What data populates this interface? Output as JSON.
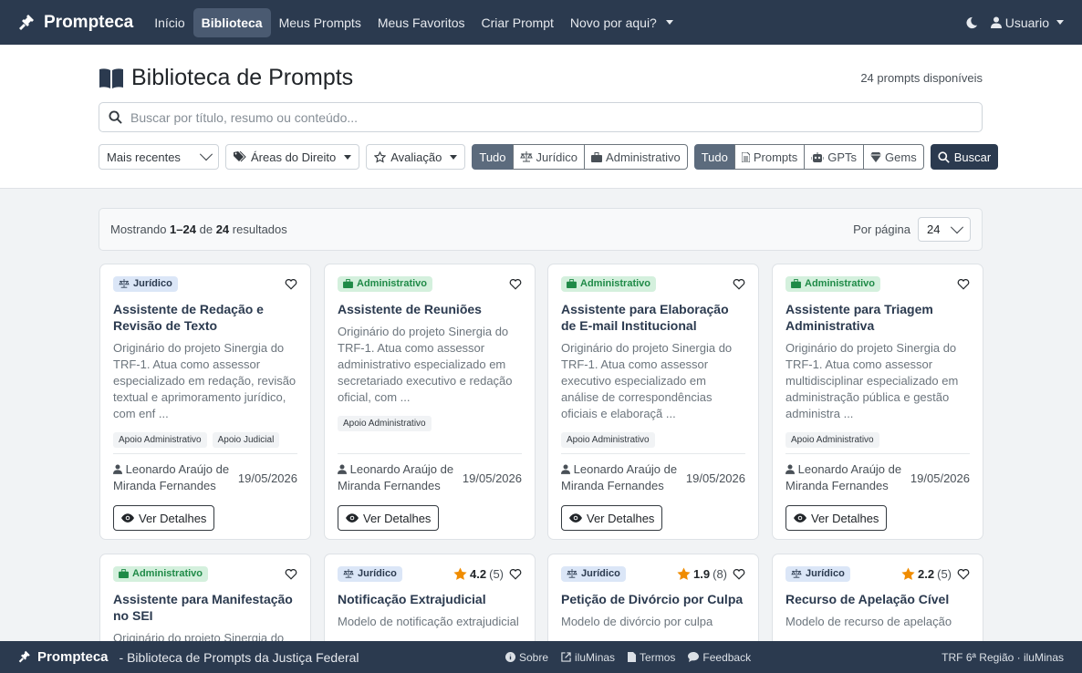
{
  "nav": {
    "brand": "Prompteca",
    "items": [
      "Início",
      "Biblioteca",
      "Meus Prompts",
      "Meus Favoritos",
      "Criar Prompt",
      "Novo por aqui?"
    ],
    "user": "Usuario"
  },
  "header": {
    "title": "Biblioteca de Prompts",
    "count": "24 prompts disponíveis",
    "search_placeholder": "Buscar por título, resumo ou conteúdo..."
  },
  "filters": {
    "sort": "Mais recentes",
    "areas": "Áreas do Direito",
    "rating": "Avaliação",
    "category_group": [
      "Tudo",
      "Jurídico",
      "Administrativo"
    ],
    "type_group": [
      "Tudo",
      "Prompts",
      "GPTs",
      "Gems"
    ],
    "search_button": "Buscar"
  },
  "results": {
    "prefix": "Mostrando",
    "range": "1–24",
    "of": "de",
    "total": "24",
    "suffix": "resultados",
    "per_page_label": "Por página",
    "per_page_value": "24"
  },
  "cards": [
    {
      "category": "Jurídico",
      "title": "Assistente de Redação e Revisão de Texto",
      "desc": "Originário do projeto Sinergia do TRF-1. Atua como assessor especializado em redação, revisão textual e aprimoramento jurídico, com enf ...",
      "tags": [
        "Apoio Administrativo",
        "Apoio Judicial"
      ],
      "author": "Leonardo Araújo de Miranda Fernandes",
      "date": "19/05/2026",
      "button": "Ver Detalhes"
    },
    {
      "category": "Administrativo",
      "title": "Assistente de Reuniões",
      "desc": "Originário do projeto Sinergia do TRF-1. Atua como assessor administrativo especializado em secretariado executivo e redação oficial, com ...",
      "tags": [
        "Apoio Administrativo"
      ],
      "author": "Leonardo Araújo de Miranda Fernandes",
      "date": "19/05/2026",
      "button": "Ver Detalhes"
    },
    {
      "category": "Administrativo",
      "title": "Assistente para Elaboração de E-mail Institucional",
      "desc": "Originário do projeto Sinergia do TRF-1. Atua como assessor executivo especializado em análise de correspondências oficiais e elaboraçã ...",
      "tags": [
        "Apoio Administrativo"
      ],
      "author": "Leonardo Araújo de Miranda Fernandes",
      "date": "19/05/2026",
      "button": "Ver Detalhes"
    },
    {
      "category": "Administrativo",
      "title": "Assistente para Triagem Administrativa",
      "desc": "Originário do projeto Sinergia do TRF-1. Atua como assessor multidisciplinar especializado em administração pública e gestão administra ...",
      "tags": [
        "Apoio Administrativo"
      ],
      "author": "Leonardo Araújo de Miranda Fernandes",
      "date": "19/05/2026",
      "button": "Ver Detalhes"
    },
    {
      "category": "Administrativo",
      "title": "Assistente para Manifestação no SEI",
      "desc": "Originário do projeto Sinergia do",
      "rating": "",
      "rating_count": ""
    },
    {
      "category": "Jurídico",
      "title": "Notificação Extrajudicial",
      "desc": "Modelo de notificação extrajudicial",
      "rating": "4.2",
      "rating_count": "(5)"
    },
    {
      "category": "Jurídico",
      "title": "Petição de Divórcio por Culpa",
      "desc": "Modelo de divórcio por culpa",
      "rating": "1.9",
      "rating_count": "(8)"
    },
    {
      "category": "Jurídico",
      "title": "Recurso de Apelação Cível",
      "desc": "Modelo de recurso de apelação",
      "rating": "2.2",
      "rating_count": "(5)"
    }
  ],
  "footer": {
    "brand": "Prompteca",
    "subtitle": "- Biblioteca de Prompts da Justiça Federal",
    "links": [
      "Sobre",
      "iluMinas",
      "Termos",
      "Feedback"
    ],
    "right": "TRF 6ª Região · iluMinas"
  },
  "colors": {
    "nav_bg": "#2b3a4f",
    "juridico_badge": "#dbe6f7",
    "admin_badge": "#d4f0dd",
    "admin_text": "#1f8a47",
    "star": "#f08c00"
  }
}
